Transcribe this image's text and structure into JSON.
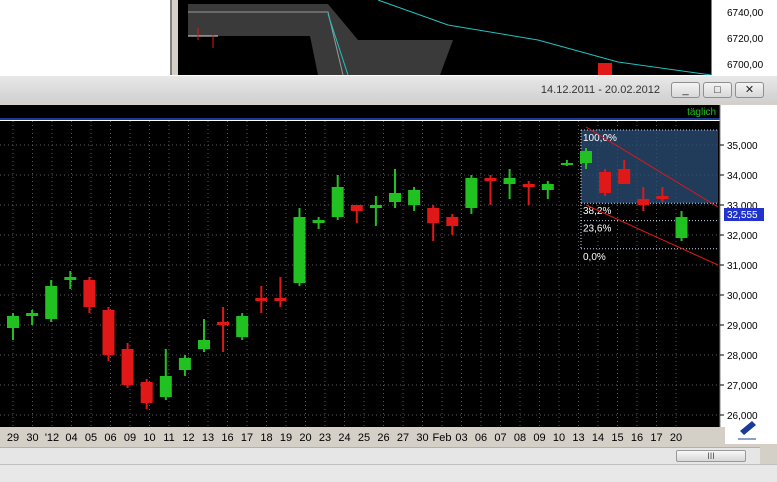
{
  "background_window": {
    "axis_labels": [
      "6740,00",
      "6720,00",
      "6700,00"
    ]
  },
  "window": {
    "date_range": "14.12.2011 - 20.02.2012",
    "buttons": {
      "minimize": "_",
      "maximize": "□",
      "close": "✕"
    },
    "period_label": "täglich",
    "current_price": "32,555",
    "y_axis_labels": [
      "35,000",
      "34,000",
      "33,000",
      "32,000",
      "31,000",
      "30,000",
      "29,000",
      "28,000",
      "27,000",
      "26,000"
    ],
    "x_axis_labels": [
      "29",
      "30",
      "'12",
      "04",
      "05",
      "06",
      "09",
      "10",
      "11",
      "12",
      "13",
      "16",
      "17",
      "18",
      "19",
      "20",
      "23",
      "24",
      "25",
      "26",
      "27",
      "30",
      "Feb",
      "03",
      "06",
      "07",
      "08",
      "09",
      "10",
      "13",
      "14",
      "15",
      "16",
      "17",
      "20"
    ],
    "fib_labels": [
      "100,0%",
      "38,2%",
      "23,6%",
      "0,0%"
    ],
    "scroll_thumb": "III"
  },
  "colors": {
    "up": "#22c122",
    "down": "#e01818",
    "background": "#000000",
    "grid": "#5a5a5a",
    "fib_box": "#2c4f7a",
    "channel": "#e01818",
    "price_tag": "#2233cc"
  },
  "chart_data": {
    "type": "candlestick",
    "title": "",
    "period": "täglich",
    "date_range": "14.12.2011 - 20.02.2012",
    "ylim": [
      25600,
      35800
    ],
    "candles": [
      {
        "x": "29",
        "o": 28.9,
        "h": 29.4,
        "l": 28.5,
        "c": 29.3
      },
      {
        "x": "30",
        "o": 29.3,
        "h": 29.5,
        "l": 29.0,
        "c": 29.4
      },
      {
        "x": "'12",
        "o": 29.2,
        "h": 30.5,
        "l": 29.1,
        "c": 30.3
      },
      {
        "x": "03",
        "o": 30.5,
        "h": 30.8,
        "l": 30.2,
        "c": 30.6
      },
      {
        "x": "04",
        "o": 30.5,
        "h": 30.6,
        "l": 29.4,
        "c": 29.6
      },
      {
        "x": "05",
        "o": 29.5,
        "h": 29.6,
        "l": 27.8,
        "c": 28.0
      },
      {
        "x": "06",
        "o": 28.2,
        "h": 28.4,
        "l": 26.9,
        "c": 27.0
      },
      {
        "x": "09",
        "o": 27.1,
        "h": 27.2,
        "l": 26.2,
        "c": 26.4
      },
      {
        "x": "10",
        "o": 26.6,
        "h": 28.2,
        "l": 26.5,
        "c": 27.3
      },
      {
        "x": "11",
        "o": 27.5,
        "h": 28.0,
        "l": 27.3,
        "c": 27.9
      },
      {
        "x": "12",
        "o": 28.2,
        "h": 29.2,
        "l": 28.1,
        "c": 28.5
      },
      {
        "x": "13",
        "o": 29.1,
        "h": 29.6,
        "l": 28.1,
        "c": 29.0
      },
      {
        "x": "16",
        "o": 28.6,
        "h": 29.4,
        "l": 28.5,
        "c": 29.3
      },
      {
        "x": "17",
        "o": 29.9,
        "h": 30.3,
        "l": 29.4,
        "c": 29.8
      },
      {
        "x": "18",
        "o": 29.9,
        "h": 30.6,
        "l": 29.6,
        "c": 29.8
      },
      {
        "x": "19",
        "o": 30.4,
        "h": 32.9,
        "l": 30.3,
        "c": 32.6
      },
      {
        "x": "20",
        "o": 32.4,
        "h": 32.6,
        "l": 32.2,
        "c": 32.5
      },
      {
        "x": "23",
        "o": 32.6,
        "h": 34.0,
        "l": 32.5,
        "c": 33.6
      },
      {
        "x": "24",
        "o": 33.0,
        "h": 33.0,
        "l": 32.4,
        "c": 32.8
      },
      {
        "x": "25",
        "o": 32.9,
        "h": 33.3,
        "l": 32.3,
        "c": 33.0
      },
      {
        "x": "26",
        "o": 33.1,
        "h": 34.2,
        "l": 32.9,
        "c": 33.4
      },
      {
        "x": "27",
        "o": 33.0,
        "h": 33.6,
        "l": 32.8,
        "c": 33.5
      },
      {
        "x": "30",
        "o": 32.9,
        "h": 33.0,
        "l": 31.8,
        "c": 32.4
      },
      {
        "x": "31",
        "o": 32.6,
        "h": 32.7,
        "l": 32.0,
        "c": 32.3
      },
      {
        "x": "01",
        "o": 32.9,
        "h": 34.0,
        "l": 32.7,
        "c": 33.9
      },
      {
        "x": "02",
        "o": 33.9,
        "h": 34.0,
        "l": 33.0,
        "c": 33.8
      },
      {
        "x": "03",
        "o": 33.7,
        "h": 34.2,
        "l": 33.2,
        "c": 33.9
      },
      {
        "x": "06",
        "o": 33.7,
        "h": 33.8,
        "l": 33.0,
        "c": 33.6
      },
      {
        "x": "07",
        "o": 33.5,
        "h": 33.8,
        "l": 33.2,
        "c": 33.7
      },
      {
        "x": "08",
        "o": 34.4,
        "h": 34.5,
        "l": 34.3,
        "c": 34.4
      },
      {
        "x": "09",
        "o": 34.4,
        "h": 34.9,
        "l": 34.2,
        "c": 34.8
      },
      {
        "x": "10",
        "o": 34.1,
        "h": 34.2,
        "l": 33.3,
        "c": 33.4
      },
      {
        "x": "13",
        "o": 34.2,
        "h": 34.5,
        "l": 33.7,
        "c": 33.7
      },
      {
        "x": "14",
        "o": 33.2,
        "h": 33.6,
        "l": 32.8,
        "c": 33.0
      },
      {
        "x": "15",
        "o": 33.3,
        "h": 33.6,
        "l": 33.1,
        "c": 33.2
      },
      {
        "x": "16",
        "o": 31.9,
        "h": 32.8,
        "l": 31.8,
        "c": 32.6
      }
    ],
    "fibonacci": [
      {
        "label": "100,0%",
        "value": 35.5
      },
      {
        "label": "38,2%",
        "value": 33.06
      },
      {
        "label": "23,6%",
        "value": 32.48
      },
      {
        "label": "0,0%",
        "value": 31.54
      }
    ],
    "current_value": 32.555
  }
}
